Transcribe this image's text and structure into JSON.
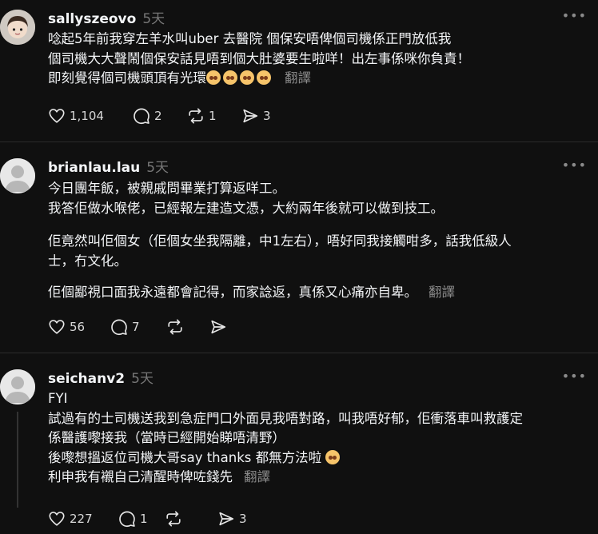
{
  "posts": [
    {
      "username": "sallyszeovo",
      "time": "5天",
      "lines": [
        "唸起5年前我穿左羊水叫uber 去醫院 個保安唔俾個司機係正門放低我",
        "個司機大大聲鬧個保安話見唔到個大肚婆要生啦咩！出左事係咪你負責！",
        "即刻覺得個司機頭頂有光環"
      ],
      "emoji_count": 4,
      "translate": "翻譯",
      "likes": "1,104",
      "replies": "2",
      "reposts": "1",
      "shares": "3"
    },
    {
      "username": "brianlau.lau",
      "time": "5天",
      "paragraphs": [
        [
          "今日團年飯，被親戚問畢業打算返咩工。",
          "我答佢做水喉佬，已經報左建造文憑，大約兩年後就可以做到技工。"
        ],
        [
          "佢竟然叫佢個女（佢個女坐我隔離，中1左右），唔好同我接觸咁多，話我低級人",
          "士，冇文化。"
        ],
        [
          "佢個鄙視口面我永遠都會記得，而家諗返，真係又心痛亦自卑。"
        ]
      ],
      "translate": "翻譯",
      "likes": "56",
      "replies": "7",
      "reposts": "",
      "shares": ""
    },
    {
      "username": "seichanv2",
      "time": "5天",
      "lines": [
        "FYI",
        "試過有的士司機送我到急症門口外面見我唔對路，叫我唔好郁，佢衝落車叫救護定",
        "係醫護嚟接我（當時已經開始睇唔清野）",
        "後嚟想搵返位司機大哥say thanks 都無方法啦",
        "利申我有襯自己清醒時俾咗錢先"
      ],
      "translate": "翻譯",
      "likes": "227",
      "replies": "1",
      "reposts": "",
      "shares": "3"
    }
  ],
  "more_label": "•••"
}
